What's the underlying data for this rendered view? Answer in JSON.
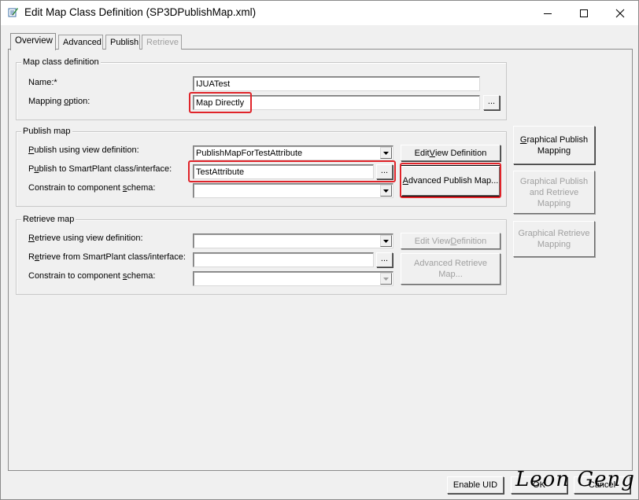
{
  "window": {
    "title": "Edit Map Class Definition (SP3DPublishMap.xml)"
  },
  "tabs": [
    {
      "label": "Overview",
      "state": "active"
    },
    {
      "label": "Advanced",
      "state": "normal"
    },
    {
      "label": "Publish",
      "state": "normal"
    },
    {
      "label": "Retrieve",
      "state": "disabled"
    }
  ],
  "map_class": {
    "title": "Map class definition",
    "name_label": "Name:*",
    "name_value": "IJUATest",
    "mapping_label_pre": "Mapping ",
    "mapping_label_key": "o",
    "mapping_label_post": "ption:",
    "mapping_value": "Map Directly",
    "browse_label": "..."
  },
  "publish_map": {
    "title": "Publish map",
    "view_label_key": "P",
    "view_label_post": "ublish using view definition:",
    "view_value": "PublishMapForTestAttribute",
    "class_label_pre": "P",
    "class_label_key": "u",
    "class_label_post": "blish to SmartPlant class/interface:",
    "class_value": "TestAttribute",
    "schema_label_pre": "Constrain to component ",
    "schema_label_key": "s",
    "schema_label_post": "chema:",
    "schema_value": "",
    "edit_view_pre": "Edit ",
    "edit_view_key": "V",
    "edit_view_post": "iew Definition",
    "advanced_key": "A",
    "advanced_post": "dvanced Publish Map...",
    "browse_label": "..."
  },
  "retrieve_map": {
    "title": "Retrieve map",
    "view_label_key": "R",
    "view_label_post": "etrieve using view definition:",
    "class_label_pre": "R",
    "class_label_key": "e",
    "class_label_post": "trieve from SmartPlant class/interface:",
    "schema_label_pre": "Constrain to component ",
    "schema_label_key": "s",
    "schema_label_post": "chema:",
    "edit_view_pre": "Edit View ",
    "edit_view_key": "D",
    "edit_view_post": "efinition",
    "advanced_label": "Advanced Retrieve Map...",
    "browse_label": "..."
  },
  "side_buttons": {
    "graphical_publish_key": "G",
    "graphical_publish_post": "raphical Publish Mapping",
    "graphical_publish_retrieve": "Graphical Publish and Retrieve Mapping",
    "graphical_retrieve": "Graphical Retrieve Mapping"
  },
  "footer": {
    "enable_uid": "Enable UID",
    "ok": "OK",
    "cancel": "Cancel"
  },
  "watermark": "Leon Geng",
  "colors": {
    "highlight": "#e0242a",
    "window_bg": "#f0f0f0"
  }
}
